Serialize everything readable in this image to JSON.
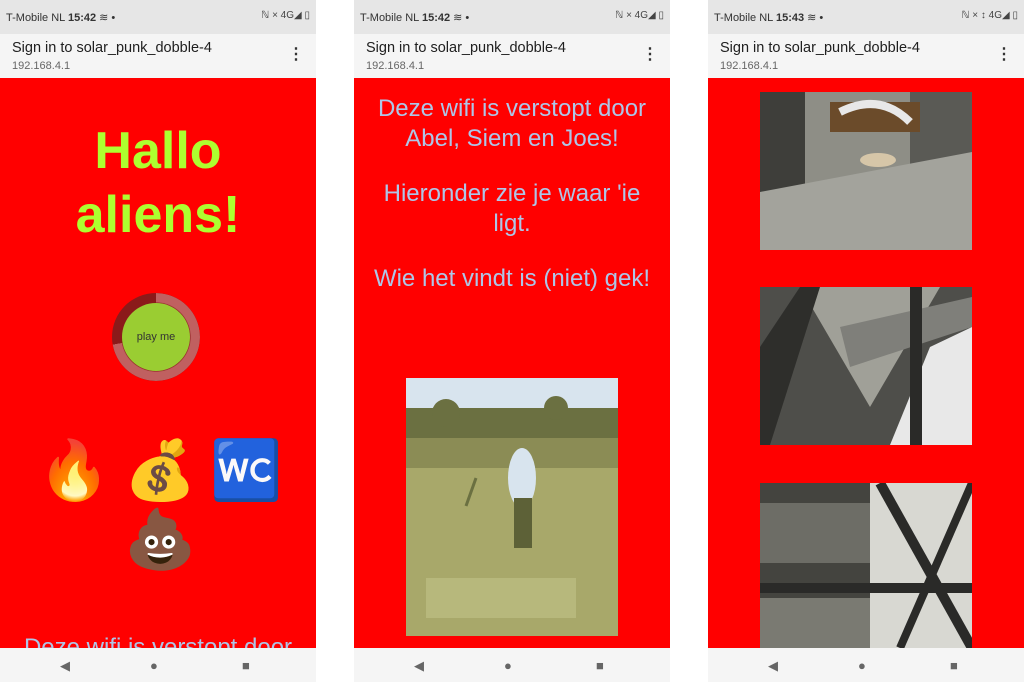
{
  "phones": [
    {
      "status": {
        "carrier": "T-Mobile  NL",
        "time": "15:42",
        "icons": "ℕ × 4G◢ ▯"
      },
      "urlbar": {
        "title": "Sign in to solar_punk_dobble-4",
        "ip": "192.168.4.1"
      },
      "hallo_line1": "Hallo",
      "hallo_line2": "aliens!",
      "play_label": "play me",
      "emojis": [
        "🔥",
        "💰",
        "🚾",
        "💩"
      ],
      "cut_text": "Deze wifi is verstopt door"
    },
    {
      "status": {
        "carrier": "T-Mobile  NL",
        "time": "15:42",
        "icons": "ℕ × 4G◢ ▯"
      },
      "urlbar": {
        "title": "Sign in to solar_punk_dobble-4",
        "ip": "192.168.4.1"
      },
      "paragraphs": [
        "Deze wifi is verstopt door Abel, Siem en Joes!",
        "Hieronder zie je waar 'ie ligt.",
        "Wie het vindt is (niet) gek!"
      ]
    },
    {
      "status": {
        "carrier": "T-Mobile  NL",
        "time": "15:43",
        "icons": "ℕ × ↕ 4G◢ ▯"
      },
      "urlbar": {
        "title": "Sign in to solar_punk_dobble-4",
        "ip": "192.168.4.1"
      }
    }
  ],
  "menu_icon": "⋮",
  "navbar": {
    "back": "◀",
    "home": "●",
    "recents": "■"
  },
  "colors": {
    "page_bg": "#ff0000",
    "hallo": "#adff2f",
    "text_blue": "#aec6e8"
  }
}
